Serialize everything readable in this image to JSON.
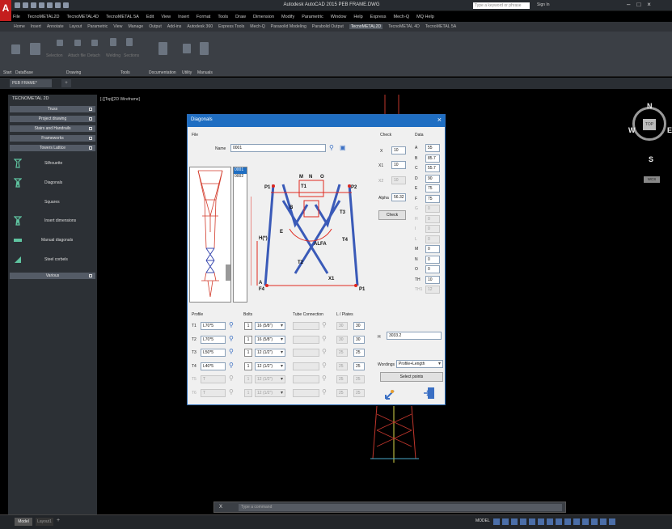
{
  "app": {
    "title": "Autodesk AutoCAD 2015   PEB FRAME.DWG",
    "search_placeholder": "Type a keyword or phrase",
    "signin": "Sign In",
    "logo": "A"
  },
  "menubar": [
    "File",
    "TecnoMETAL2D",
    "TecnoMETAL4D",
    "TecnoMETAL 5A",
    "Edit",
    "View",
    "Insert",
    "Format",
    "Tools",
    "Draw",
    "Dimension",
    "Modify",
    "Parametric",
    "Window",
    "Help",
    "Express",
    "Mech-Q",
    "MQ Help"
  ],
  "ribbon_tabs": [
    "Home",
    "Insert",
    "Annotate",
    "Layout",
    "Parametric",
    "View",
    "Manage",
    "Output",
    "Add-ins",
    "Autodesk 360",
    "Express Tools",
    "Mech-Q",
    "Parasolid Modeling",
    "Parabolid Output",
    "TecnoMETAL2D",
    "TecnoMETAL 4D",
    "TecnoMETAL 5A"
  ],
  "ribbon_active_tab": "TecnoMETAL2D",
  "ribbon_labels": [
    "Selection",
    "Attach file",
    "Detach",
    "Welding",
    "Sections",
    "Documentation",
    "Utility",
    "Manuals"
  ],
  "ribbon_panels": [
    "Start",
    "DataBase",
    "Drawing",
    "Tools",
    "Documentation",
    "Utility",
    "Manuals"
  ],
  "doc_tab": "PEB FRAME*",
  "left_panel": {
    "title": "TECNOMETAL 2D",
    "headers": [
      "Truss",
      "Project drawing",
      "Stairs and Handrails",
      "Frameworks",
      "Towers Lattice"
    ],
    "items": [
      "Silhouette",
      "Diagonals",
      "Squares",
      "Insert dimensions",
      "Manual diagonals",
      "Steel corbels"
    ],
    "footer_header": "Various"
  },
  "viewport": {
    "label": "[-][Top][2D Wireframe]",
    "compass": {
      "n": "N",
      "s": "S",
      "e": "E",
      "w": "W",
      "top": "TOP"
    },
    "wcs": "WCS"
  },
  "dialog": {
    "title": "Diagonals",
    "file_label": "File",
    "name_label": "Name",
    "name_value": "0001",
    "codes": [
      "0001",
      "0002"
    ],
    "check_label": "Check",
    "data_label": "Data",
    "x_label": "X",
    "x_value": "10",
    "x1_label": "X1",
    "x1_value": "10",
    "x2_label": "X2",
    "x2_value": "10",
    "alpha_label": "Alpha",
    "alpha_value": "56.32",
    "check_button": "Check",
    "data_rows": [
      {
        "k": "A",
        "v": "55",
        "en": true
      },
      {
        "k": "B",
        "v": "85.7",
        "en": true
      },
      {
        "k": "C",
        "v": "55.7",
        "en": true
      },
      {
        "k": "D",
        "v": "90",
        "en": true
      },
      {
        "k": "E",
        "v": "75",
        "en": true
      },
      {
        "k": "F",
        "v": "75",
        "en": true
      },
      {
        "k": "G",
        "v": "0",
        "en": false
      },
      {
        "k": "H",
        "v": "0",
        "en": false
      },
      {
        "k": "I",
        "v": "0",
        "en": false
      },
      {
        "k": "L",
        "v": "0",
        "en": false
      },
      {
        "k": "M",
        "v": "0",
        "en": true
      },
      {
        "k": "N",
        "v": "0",
        "en": true
      },
      {
        "k": "O",
        "v": "0",
        "en": true
      },
      {
        "k": "TH",
        "v": "10",
        "en": true
      },
      {
        "k": "TH1",
        "v": "12",
        "en": false
      }
    ],
    "profile_label": "Profile",
    "bolts_label": "Bolts",
    "tube_label": "Tube Connection",
    "plates_label": "L / Plates",
    "rows": [
      {
        "k": "T1",
        "p": "L70*5",
        "b1": "1",
        "b2": "16 (5/8\")",
        "t": "",
        "l1": "30",
        "l2": "30",
        "en": true
      },
      {
        "k": "T2",
        "p": "L70*5",
        "b1": "1",
        "b2": "16 (5/8\")",
        "t": "",
        "l1": "30",
        "l2": "30",
        "en": true
      },
      {
        "k": "T3",
        "p": "L50*5",
        "b1": "1",
        "b2": "12 (1/2\")",
        "t": "",
        "l1": "25",
        "l2": "25",
        "en": true
      },
      {
        "k": "T4",
        "p": "L40*5",
        "b1": "1",
        "b2": "12 (1/2\")",
        "t": "",
        "l1": "25",
        "l2": "25",
        "en": true
      },
      {
        "k": "T5",
        "p": "T",
        "b1": "1",
        "b2": "12 (1/2\")",
        "t": "",
        "l1": "25",
        "l2": "25",
        "en": false
      },
      {
        "k": "T6",
        "p": "T",
        "b1": "1",
        "b2": "12 (1/2\")",
        "t": "",
        "l1": "25",
        "l2": "25",
        "en": false
      }
    ],
    "h_label": "H",
    "h_value": "3033.2",
    "wordings_label": "Wordings",
    "wordings_value": "Profile+Length",
    "select_points": "Select points",
    "drawing_labels": [
      "M",
      "N",
      "O",
      "P1",
      "P2",
      "P",
      "T1",
      "T2",
      "T3",
      "T4",
      "B",
      "A",
      "E",
      "F",
      "H(*)",
      "ALFA",
      "X1",
      "F4",
      "X",
      "F2"
    ]
  },
  "command": {
    "placeholder": "Type a command",
    "x": "X"
  },
  "status": {
    "model": "Model",
    "layout": "Layout1",
    "model_right": "MODEL"
  },
  "colors": {
    "accent": "#1f6ec2",
    "drawing_red": "#e0281e",
    "drawing_blue": "#3a5ab8"
  }
}
